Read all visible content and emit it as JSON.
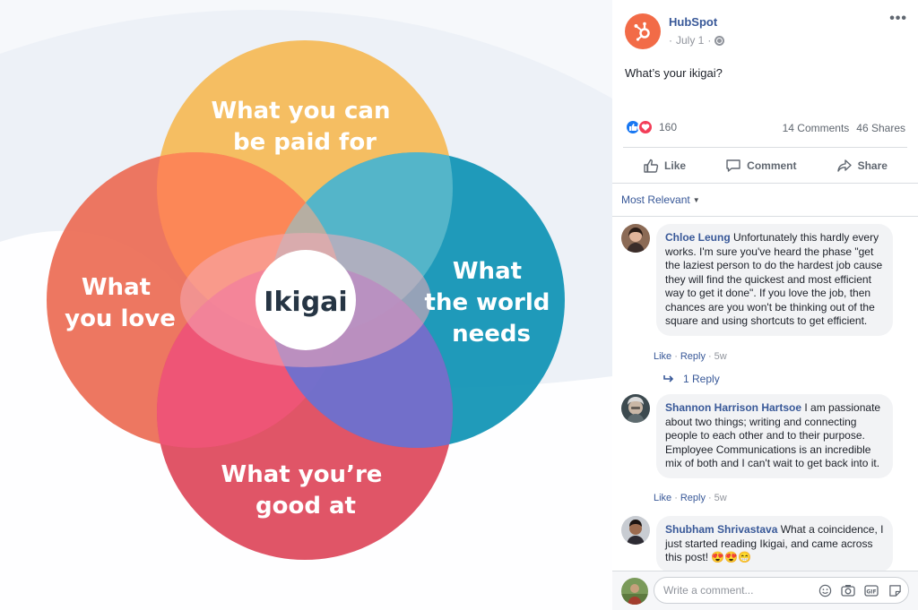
{
  "ikigai_image": {
    "center": "Ikigai",
    "circles": [
      {
        "label": [
          "What you can",
          "be paid for"
        ],
        "color": "#f5bb5a"
      },
      {
        "label": [
          "What",
          "you love"
        ],
        "color": "#ec6b54"
      },
      {
        "label": [
          "What",
          "the world",
          "needs"
        ],
        "color": "#0d92b4"
      },
      {
        "label": [
          "What you’re",
          "good at"
        ],
        "color": "#dd4257"
      }
    ]
  },
  "post": {
    "page_name": "HubSpot",
    "date": "July 1",
    "separator": "·",
    "text": "What’s your ikigai?",
    "reaction_count": "160",
    "comments_count": "14 Comments",
    "shares_count": "46 Shares",
    "more_label": "•••"
  },
  "actions": {
    "like": "Like",
    "comment": "Comment",
    "share": "Share"
  },
  "comments_section": {
    "sort_label": "Most Relevant",
    "comments": [
      {
        "author": "Chloe Leung",
        "text": "Unfortunately this hardly every works. I'm sure you've heard the phase \"get the laziest person to do the hardest job cause they will find the quickest and most efficient way to get it done\". If you love the job, then chances are you won't be thinking out of the square and using shortcuts to get efficient.",
        "like": "Like",
        "reply": "Reply",
        "time": "5w",
        "replies": "1 Reply"
      },
      {
        "author": "Shannon Harrison Hartsoe",
        "text": "I am passionate about two things; writing and connecting people to each other and to their purpose. Employee Communications is an incredible mix of both and I can't wait to get back into it.",
        "like": "Like",
        "reply": "Reply",
        "time": "5w"
      },
      {
        "author": "Shubham Shrivastava",
        "text": "What a coincidence, I just started reading Ikigai, and came across this post!",
        "emoji": "😍😍😁"
      }
    ],
    "write_placeholder": "Write a comment..."
  },
  "icons": [
    "hubspot-logo-icon",
    "globe-icon",
    "more-icon",
    "like-reaction-icon",
    "love-reaction-icon",
    "like-icon",
    "comment-icon",
    "share-icon",
    "reply-arrow-icon",
    "emoji-icon",
    "camera-icon",
    "gif-icon",
    "sticker-icon"
  ]
}
